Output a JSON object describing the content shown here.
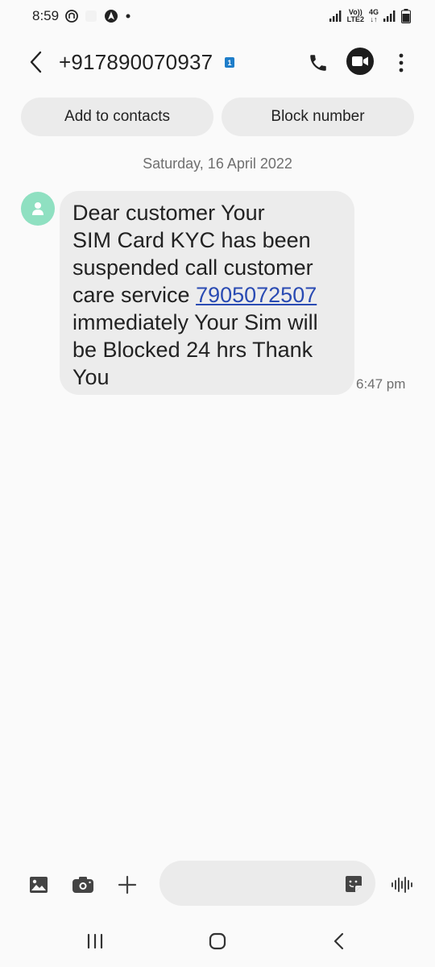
{
  "status_bar": {
    "time": "8:59",
    "volte_label": "Vo))",
    "lte_label": "LTE2",
    "net_label": "4G"
  },
  "header": {
    "contact_number": "+917890070937",
    "sim_badge": "1"
  },
  "actions": {
    "add_contacts": "Add to contacts",
    "block_number": "Block number"
  },
  "conversation": {
    "date": "Saturday, 16 April 2022",
    "message": {
      "line1": "Dear customer Your",
      "line2": "SIM Card KYC has been",
      "line3": "suspended call customer",
      "line4_prefix": "care service ",
      "link_number": "7905072507",
      "line5": "immediately Your Sim will",
      "line6": "be Blocked 24 hrs Thank",
      "line7": "You",
      "time": "6:47 pm"
    }
  },
  "composer": {
    "placeholder": "",
    "icons": [
      "gallery-icon",
      "camera-icon",
      "plus-icon",
      "sticker-icon",
      "voice-icon"
    ]
  },
  "colors": {
    "avatar": "#8fe0c1",
    "bubble": "#ececec",
    "link": "#2a4bb3",
    "sim_badge": "#1e7dc9"
  }
}
